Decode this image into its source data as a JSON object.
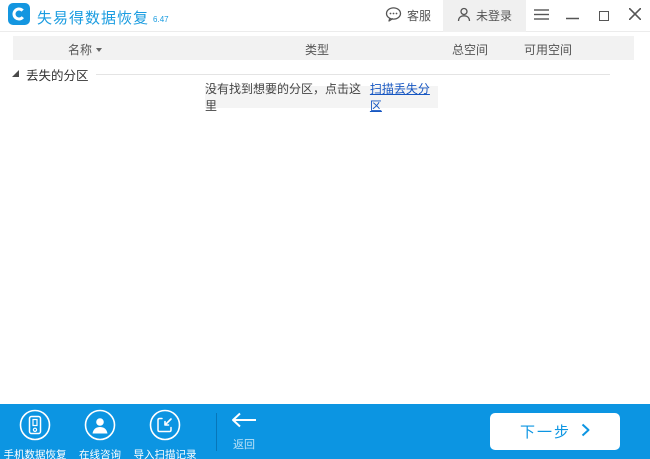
{
  "window": {
    "title": "失易得数据恢复",
    "version": "6.47"
  },
  "titlebar": {
    "support_label": "客服",
    "login_label": "未登录",
    "icons": [
      "chat-bubble-icon",
      "user-icon",
      "menu-icon",
      "minimize-icon",
      "maximize-icon",
      "close-icon"
    ]
  },
  "table": {
    "columns": {
      "name": "名称",
      "type": "类型",
      "total_space": "总空间",
      "free_space": "可用空间"
    }
  },
  "tree": {
    "group_label": "丢失的分区",
    "expanded": true
  },
  "empty_message": {
    "text": "没有找到想要的分区，点击这里",
    "link_label": "扫描丢失分区"
  },
  "bottombar": {
    "actions": [
      {
        "label": "手机数据恢复",
        "icon": "phone-icon"
      },
      {
        "label": "在线咨询",
        "icon": "person-icon"
      },
      {
        "label": "导入扫描记录",
        "icon": "import-icon"
      }
    ],
    "back_label": "返回",
    "next_label": "下一步"
  },
  "colors": {
    "accent_blue": "#0c95e2",
    "title_blue": "#1a9ce0",
    "link_blue": "#1757c2",
    "header_gray": "#f2f2f2",
    "text_gray": "#555555"
  }
}
